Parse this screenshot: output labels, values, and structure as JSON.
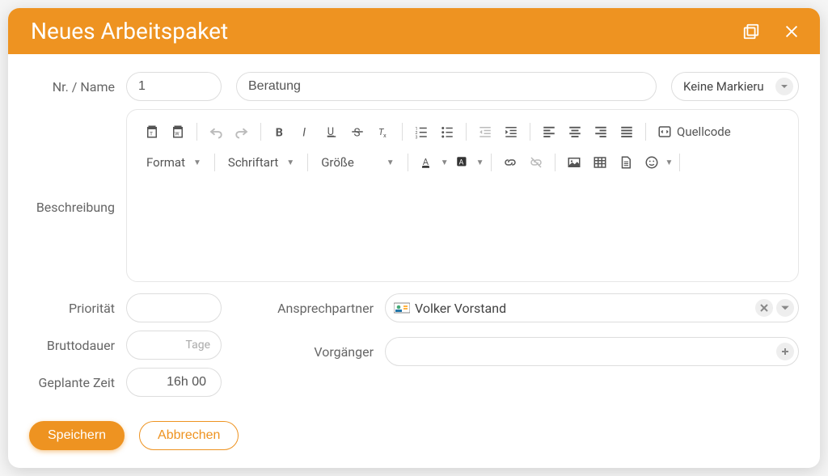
{
  "header": {
    "title": "Neues Arbeitspaket"
  },
  "labels": {
    "nr_name": "Nr. / Name",
    "description": "Beschreibung",
    "priority": "Priorität",
    "gross_duration": "Bruttodauer",
    "planned_time": "Geplante Zeit",
    "contact": "Ansprechpartner",
    "predecessor": "Vorgänger",
    "duration_unit": "Tage"
  },
  "fields": {
    "nr": "1",
    "name": "Beratung",
    "marking": "Keine Markieru",
    "priority": "",
    "gross_duration": "",
    "planned_time": "16h 00",
    "contact_name": "Volker Vorstand",
    "predecessor": ""
  },
  "editor": {
    "format": "Format",
    "font": "Schriftart",
    "size": "Größe",
    "sourcecode": "Quellcode"
  },
  "footer": {
    "save": "Speichern",
    "cancel": "Abbrechen"
  }
}
